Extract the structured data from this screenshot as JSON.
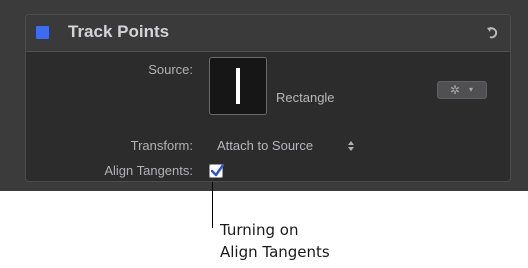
{
  "panel": {
    "title": "Track Points",
    "enable_color": "#3c6cf0",
    "reset_icon": "reset-arrow-icon"
  },
  "rows": {
    "source": {
      "label": "Source:",
      "value": "Rectangle",
      "action_icon": "gear-icon",
      "action_caret": "▾"
    },
    "transform": {
      "label": "Transform:",
      "value": "Attach to Source",
      "stepper": "⇕"
    },
    "align_tangents": {
      "label": "Align Tangents:",
      "checked": true
    }
  },
  "callout": {
    "line1": "Turning on",
    "line2": "Align Tangents"
  }
}
